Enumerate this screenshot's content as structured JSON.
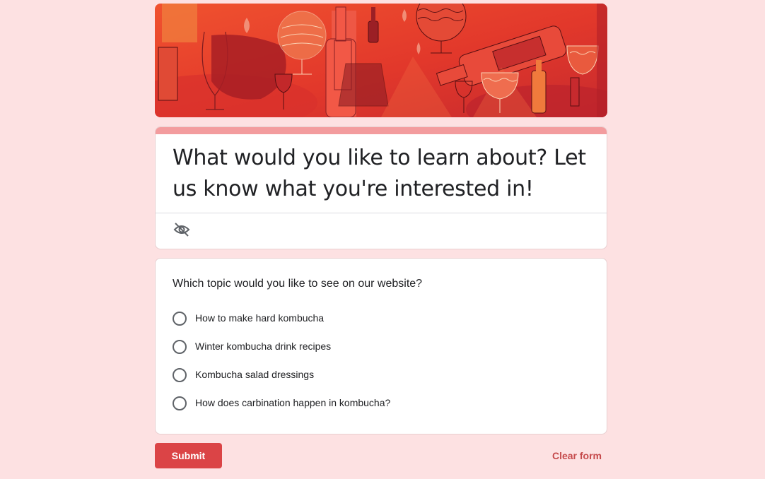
{
  "form": {
    "title": "What would you like to learn about? Let us know what you're interested in!",
    "visibility_icon": "eye-off-icon",
    "accent_color": "#f39c9e",
    "background_color": "#fde1e2"
  },
  "banner": {
    "theme": "wine-glasses-and-bottles-illustration",
    "colors": [
      "#e63e2c",
      "#c0262a",
      "#f07a3c"
    ]
  },
  "question": {
    "title": "Which topic would you like to see on our website?",
    "options": [
      {
        "label": "How to make hard kombucha"
      },
      {
        "label": "Winter kombucha drink recipes"
      },
      {
        "label": "Kombucha salad dressings"
      },
      {
        "label": "How does carbination happen in kombucha?"
      }
    ]
  },
  "actions": {
    "submit_label": "Submit",
    "submit_color": "#db4446",
    "clear_label": "Clear form"
  }
}
